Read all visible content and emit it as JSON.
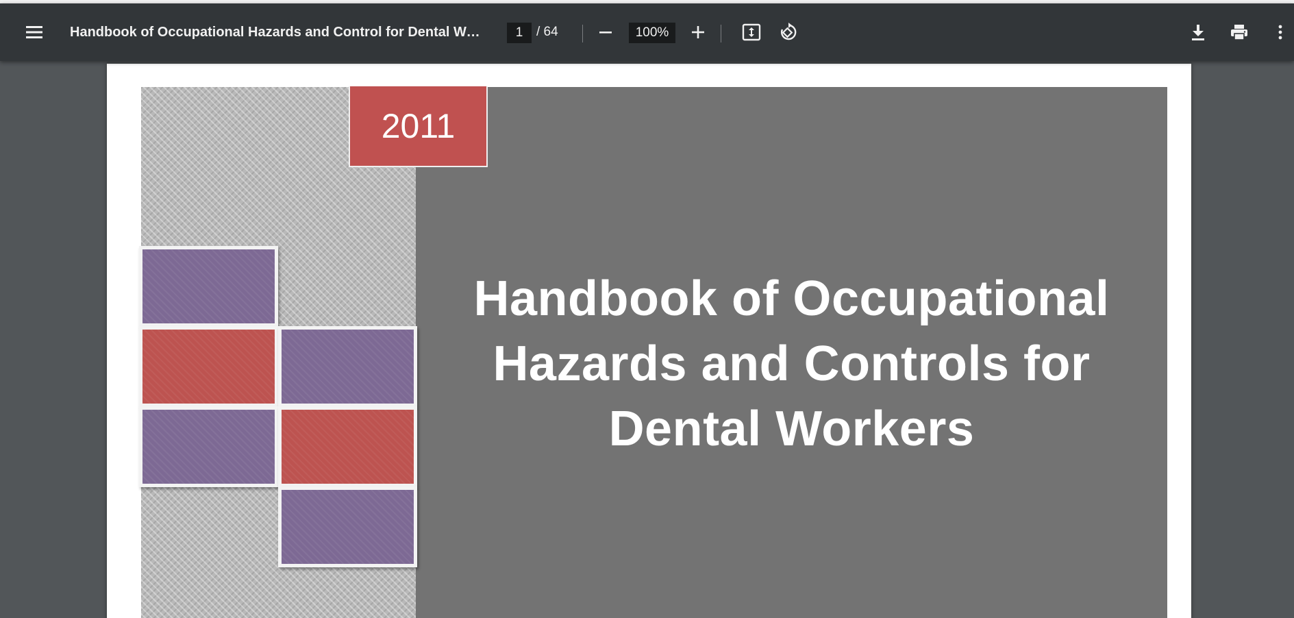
{
  "toolbar": {
    "title": "Handbook of Occupational Hazards and Control for Dental Wor…",
    "page_current": "1",
    "page_total": "/ 64",
    "zoom": "100%",
    "icons": {
      "menu": "hamburger-menu-icon",
      "zoom_out": "minus-icon",
      "zoom_in": "plus-icon",
      "fit": "fit-to-page-icon",
      "rotate": "rotate-icon",
      "download": "download-icon",
      "print": "print-icon",
      "more": "more-vertical-icon"
    }
  },
  "cover": {
    "year": "2011",
    "title_lines": [
      "Handbook of Occupational",
      "Hazards and Controls for",
      "Dental Workers"
    ],
    "colors": {
      "red": "#c05150",
      "purple": "#7d6994",
      "gray": "#737373"
    }
  }
}
